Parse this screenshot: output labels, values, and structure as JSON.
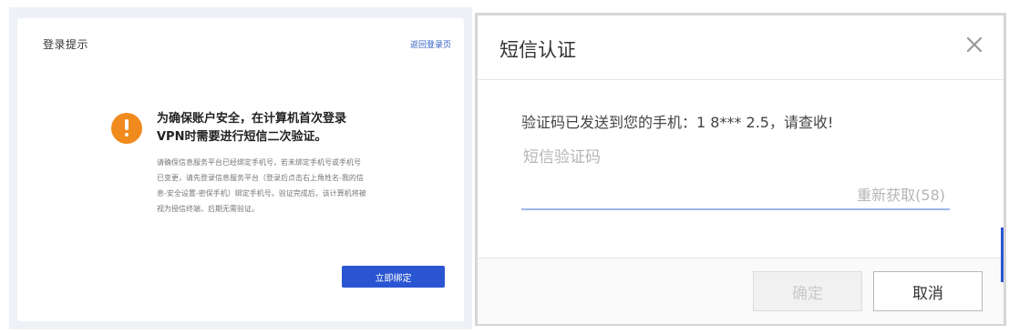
{
  "left_panel": {
    "title": "登录提示",
    "back_link": "返回登录页",
    "headline_line1": "为确保账户安全，在计算机首次登录",
    "headline_line2": "VPN时需要进行短信二次验证。",
    "description": "请确保信息服务平台已经绑定手机号，若未绑定手机号或手机号已变更，请先登录信息服务平台（登录后点击右上角姓名-我的信息-安全设置-密保手机）绑定手机号。验证完成后，该计算机将被视为授信终端，后期无需验证。",
    "bind_button": "立即绑定",
    "icon": "warning-icon",
    "accent_color": "#2a55d2",
    "warning_color": "#f08a1c"
  },
  "dialog": {
    "title": "短信认证",
    "message": "验证码已发送到您的手机：1 8***  2.5，请查收!",
    "input_placeholder": "短信验证码",
    "input_value": "",
    "resend_label": "重新获取(58)",
    "ok_button": "确定",
    "cancel_button": "取消",
    "close_icon": "close-icon"
  }
}
